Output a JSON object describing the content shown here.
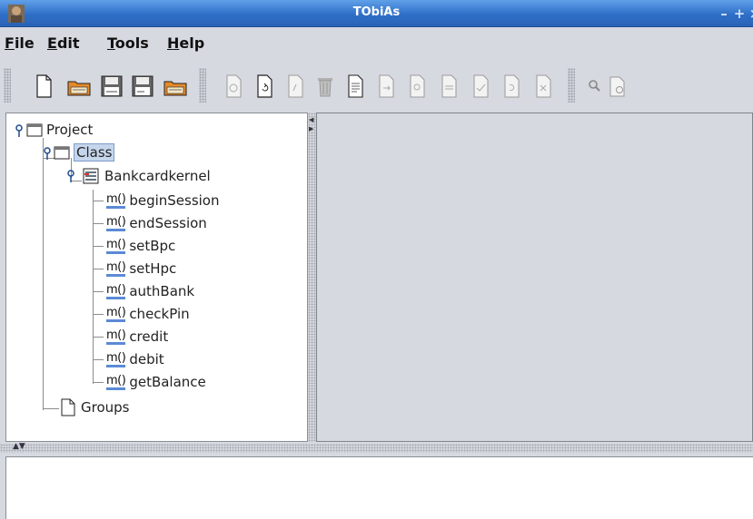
{
  "window": {
    "title": "TObiAs",
    "minimize": "–",
    "maximize": "+",
    "close": "×"
  },
  "menu": [
    {
      "mnemonic": "F",
      "rest": "ile"
    },
    {
      "mnemonic": "E",
      "rest": "dit"
    },
    {
      "mnemonic": "T",
      "rest": "ools"
    },
    {
      "mnemonic": "H",
      "rest": "elp"
    }
  ],
  "toolbar": {
    "group1": [
      "new-file-icon",
      "open-folder-icon",
      "save-icon",
      "save-as-icon",
      "open-folder-alt-icon"
    ],
    "group2": [
      "generate-icon",
      "regenerate-icon",
      "script-icon",
      "trash-icon",
      "document-icon",
      "export-icon",
      "import-icon",
      "convert-icon",
      "validate-icon",
      "sync-icon",
      "transform-icon"
    ],
    "group3": [
      "search-icon",
      "properties-icon"
    ]
  },
  "tree": {
    "root": "Project",
    "class_folder": "Class",
    "class_name": "Bankcardkernel",
    "method_tag": "m()",
    "methods": [
      "beginSession",
      "endSession",
      "setBpc",
      "setHpc",
      "authBank",
      "checkPin",
      "credit",
      "debit",
      "getBalance"
    ],
    "groups": "Groups"
  },
  "colors": {
    "titlebar": "#2f6fc8",
    "selection": "#c5d6ec",
    "method_underline": "#5b8ad6"
  }
}
